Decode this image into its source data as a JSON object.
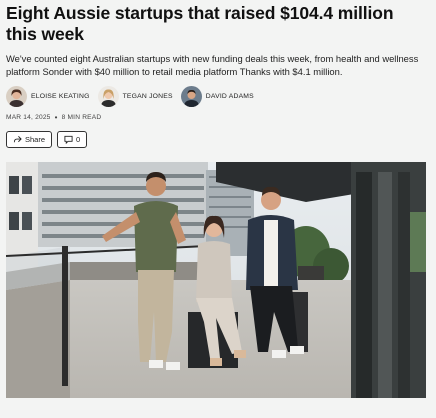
{
  "article": {
    "title": "Eight Aussie startups that raised $104.4 million this week",
    "summary": "We've counted eight Australian startups with new funding deals this week, from health and wellness platform Sonder with $40 million to retail media platform Thanks with $4.1 million.",
    "authors": [
      {
        "name": "ELOISE KEATING"
      },
      {
        "name": "TEGAN JONES"
      },
      {
        "name": "DAVID ADAMS"
      }
    ],
    "date": "MAR 14, 2025",
    "read_time": "8 MIN READ",
    "share_label": "Share",
    "comment_count": "0"
  },
  "icons": {
    "share": "share-icon",
    "comment": "comment-icon"
  }
}
